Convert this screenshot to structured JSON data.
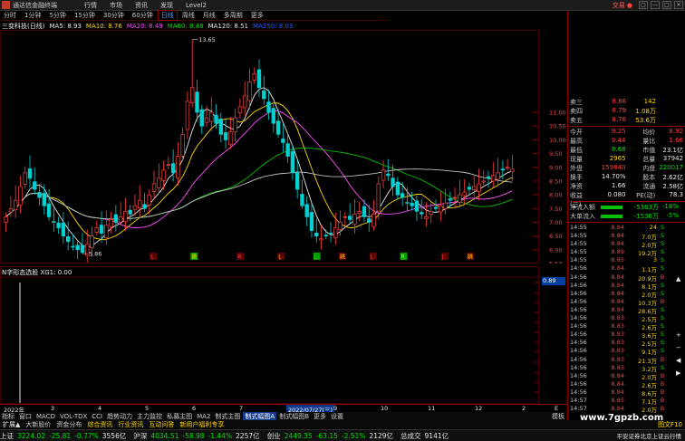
{
  "window": {
    "app_name": "通达信金融终端",
    "menu": [
      "行情",
      "市场",
      "资讯",
      "发现",
      "Level2"
    ],
    "brand": "交易",
    "brand_badge": "●",
    "win_buttons": [
      "▢",
      "—",
      "□",
      "✕"
    ]
  },
  "periods": {
    "items": [
      "分时",
      "1分钟",
      "5分钟",
      "15分钟",
      "30分钟",
      "60分钟",
      "日线",
      "周线",
      "月线",
      "多周期",
      "更多"
    ],
    "active": "日线"
  },
  "ma_legend": {
    "stock": "三变科技(日线)",
    "ma5": "MA5: 8.93",
    "ma10": "MA10: 8.76",
    "ma20": "MA20: 8.49",
    "ma60": "MA60: 8.48",
    "ma120": "MA120: 8.51",
    "ma250": "MA250: 8.03"
  },
  "colors": {
    "up": "#ff4040",
    "down": "#00e000",
    "ma5": "#e8e8e8",
    "ma10": "#ffd700",
    "ma20": "#ff50ff",
    "ma60": "#00c000",
    "ma120": "#c0c0c0",
    "ma250": "#2060ff",
    "accent": "#8a0000"
  },
  "chart_data": [
    {
      "type": "candlestick",
      "title": "三变科技(日线)",
      "ylim": [
        5.5,
        14.0
      ],
      "y_ticks": [
        11.0,
        10.5,
        10.0,
        9.5,
        9.0,
        8.5,
        8.0,
        7.5,
        7.0,
        6.5,
        6.0,
        5.5
      ],
      "annotations": [
        {
          "label": "13.65"
        },
        {
          "label": "5.86"
        }
      ],
      "series": [
        {
          "name": "close",
          "values": [
            7.2,
            7.5,
            7.8,
            8.3,
            8.8,
            8.6,
            8.2,
            7.9,
            7.6,
            7.2,
            7.0,
            6.8,
            6.5,
            6.3,
            6.1,
            6.0,
            5.9,
            6.2,
            6.5,
            6.8,
            6.6,
            6.9,
            7.1,
            7.0,
            7.2,
            7.4,
            7.3,
            7.6,
            7.8,
            7.5,
            8.0,
            8.4,
            8.6,
            8.9,
            9.1,
            8.8,
            9.4,
            10.2,
            11.4,
            11.9,
            11.0,
            10.5,
            10.8,
            11.0,
            10.6,
            10.2,
            10.0,
            10.3,
            10.8,
            11.2,
            11.6,
            12.1,
            12.4,
            11.9,
            11.5,
            11.0,
            10.6,
            10.2,
            9.9,
            9.4,
            8.8,
            8.2,
            7.6,
            7.2,
            6.7,
            6.5,
            6.4,
            6.5,
            6.6,
            6.8,
            7.0,
            7.2,
            7.1,
            7.3,
            7.4,
            7.2,
            7.0,
            7.3,
            8.4,
            8.9,
            8.7,
            8.3,
            8.0,
            7.9,
            7.7,
            7.6,
            7.4,
            7.3,
            7.2,
            7.4,
            7.5,
            7.6,
            7.7,
            7.8,
            7.9,
            8.0,
            8.1,
            8.2,
            8.3,
            8.4,
            8.5,
            8.6,
            8.7,
            8.8,
            8.9,
            9.0,
            8.93
          ]
        }
      ]
    },
    {
      "type": "bar",
      "title": "N字形态选股  XG1: 0.00",
      "ylim": [
        0,
        1
      ]
    }
  ],
  "signals": [
    "L",
    "跳",
    "R",
    "L",
    "J",
    "跳",
    "L",
    "R",
    "J",
    "跳"
  ],
  "main_chart_labels": [
    "5.86",
    "13.65"
  ],
  "sub_title": "N字形态选股  XG1: 0.00",
  "sub_y_label": "0.89",
  "date_axis": {
    "labels": [
      "2022年",
      "3",
      "4",
      "5",
      "6",
      "7",
      "2022/07/27(三)",
      "9",
      "10",
      "11",
      "12",
      "2"
    ],
    "arrow": "E"
  },
  "quote": {
    "asks": [
      {
        "label": "卖三",
        "price": "8.88",
        "vol": "142",
        "flag": ""
      },
      {
        "label": "卖四",
        "price": "8.79",
        "vol": "1.08万",
        "flag": ""
      },
      {
        "label": "卖五",
        "price": "8.78",
        "vol": "53.6万",
        "flag": ""
      }
    ],
    "stats": [
      {
        "k1": "今开",
        "v1": "9.25",
        "k2": "均价",
        "v2": "8.92"
      },
      {
        "k1": "最高",
        "v1": "9.44",
        "k2": "量比",
        "v2": "1.66"
      },
      {
        "k1": "最低",
        "v1": "8.68",
        "k2": "市值",
        "v2": "23.1亿"
      },
      {
        "k1": "现量",
        "v1": "2965",
        "k2": "总量",
        "v2": "37942"
      },
      {
        "k1": "外盘",
        "v1": "159840",
        "k2": "内盘",
        "v2": "220017"
      },
      {
        "k1": "换手",
        "v1": "14.70%",
        "k2": "股本",
        "v2": "2.62亿"
      },
      {
        "k1": "净资",
        "v1": "1.66",
        "k2": "流通",
        "v2": "2.58亿"
      },
      {
        "k1": "收益(三)",
        "v1": "0.080",
        "k2": "PE(动)",
        "v2": "78.3"
      }
    ],
    "flows": [
      {
        "label": "净流入额",
        "value": "-5363万",
        "pct": "-18%"
      },
      {
        "label": "大单流入",
        "value": "-1536万",
        "pct": "-5%"
      }
    ],
    "ticks": [
      {
        "t": "14:55",
        "p": "8.84",
        "v": "24",
        "s": "S"
      },
      {
        "t": "14:55",
        "p": "8.84",
        "v": "7.0万",
        "s": "S"
      },
      {
        "t": "14:55",
        "p": "8.84",
        "v": "2.0万",
        "s": "S"
      },
      {
        "t": "14:55",
        "p": "8.89",
        "v": "19.2万",
        "s": "S"
      },
      {
        "t": "14:55",
        "p": "8.85",
        "v": "3",
        "s": "S"
      },
      {
        "t": "14:56",
        "p": "8.84",
        "v": "1.1万",
        "s": "S"
      },
      {
        "t": "14:56",
        "p": "8.84",
        "v": "20.9万",
        "s": "B"
      },
      {
        "t": "14:56",
        "p": "8.84",
        "v": "8.1万",
        "s": "S"
      },
      {
        "t": "14:56",
        "p": "8.84",
        "v": "2.0万",
        "s": "S"
      },
      {
        "t": "14:56",
        "p": "8.84",
        "v": "10.3万",
        "s": "B"
      },
      {
        "t": "14:56",
        "p": "8.84",
        "v": "28.6万",
        "s": "S"
      },
      {
        "t": "14:56",
        "p": "8.83",
        "v": "2.5万",
        "s": "S"
      },
      {
        "t": "14:56",
        "p": "8.83",
        "v": "2.6万",
        "s": "S"
      },
      {
        "t": "14:56",
        "p": "8.83",
        "v": "3.6万",
        "s": "S"
      },
      {
        "t": "14:56",
        "p": "8.83",
        "v": "2.5万",
        "s": "S"
      },
      {
        "t": "14:56",
        "p": "8.83",
        "v": "9.1万",
        "s": "S"
      },
      {
        "t": "14:56",
        "p": "8.83",
        "v": "21.3万",
        "s": "B"
      },
      {
        "t": "14:56",
        "p": "8.83",
        "v": "3.2万",
        "s": "S"
      },
      {
        "t": "14:56",
        "p": "8.84",
        "v": "2.0万",
        "s": "B"
      },
      {
        "t": "14:56",
        "p": "8.84",
        "v": "2.6万",
        "s": "B"
      },
      {
        "t": "14:56",
        "p": "8.84",
        "v": "8.6万",
        "s": "B"
      },
      {
        "t": "14:57",
        "p": "8.85",
        "v": "7.1万",
        "s": "B"
      },
      {
        "t": "14:57",
        "p": "8.84",
        "v": "2.0万",
        "s": "B"
      }
    ]
  },
  "tabs1": [
    "指标",
    "窗口",
    "MACD",
    "VOL-TDX",
    "CCI",
    "趋势动力",
    "主力监控",
    "私募主图",
    "MA2",
    "制式主图",
    "制式幅图A",
    "制式幅图B",
    "更多",
    "设置"
  ],
  "tabs1_right": "模板",
  "tabs2": [
    "扩展▲",
    "大新股价",
    "资金分布",
    "综合资讯",
    "行业资讯",
    "互动问答",
    "新用户福利专享"
  ],
  "tabs2_right": "图文F10",
  "status": [
    {
      "k": "上证",
      "v": "3224.02",
      "c": "-25.81",
      "p": "-0.77%",
      "a": "3556亿"
    },
    {
      "k": "沪深",
      "v": "4034.51",
      "c": "-58.98",
      "p": "-1.44%",
      "a": "2257亿"
    },
    {
      "k": "创业",
      "v": "2449.35",
      "c": "-63.15",
      "p": "-2.51%",
      "a": "2129亿"
    },
    {
      "k": "总成交",
      "v": "9141亿",
      "c": "",
      "p": "",
      "a": ""
    }
  ],
  "status_right": "平安证券北京上证云行情",
  "watermark": "www.7gpzb.com",
  "scroll_icons": [
    "▲",
    "+",
    "−",
    "◀",
    "▶"
  ]
}
